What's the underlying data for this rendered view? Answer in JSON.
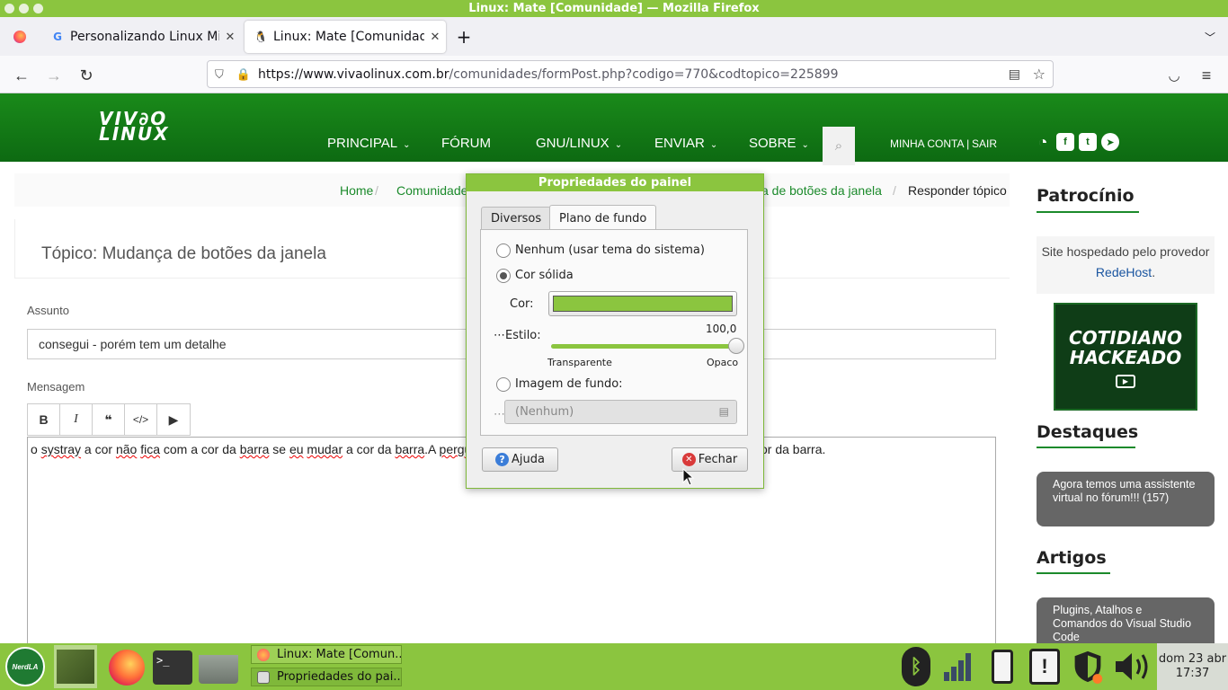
{
  "window": {
    "title": "Linux: Mate [Comunidade] — Mozilla Firefox"
  },
  "tabs": [
    {
      "label": "Personalizando Linux Mint -"
    },
    {
      "label": "Linux: Mate [Comunidade]"
    }
  ],
  "address": {
    "url_host": "https://www.vivaolinux.com.br",
    "url_path": "/comunidades/formPost.php?codigo=770&codtopico=225899"
  },
  "site": {
    "logo_line1": "VIV∂O",
    "logo_line2": "LINUX",
    "menu": [
      "PRINCIPAL",
      "FÓRUM",
      "GNU/LINUX",
      "ENVIAR",
      "SOBRE"
    ],
    "account": "MINHA CONTA",
    "logout": "SAIR"
  },
  "breadcrumb": {
    "home": "Home",
    "community": "Comunidade",
    "topic": "a de botões da janela",
    "current": "Responder tópico"
  },
  "topic_title": "Tópico: Mudança de botões da janela",
  "form": {
    "subject_label": "Assunto",
    "subject_value": "consegui - porém tem um detalhe",
    "message_label": "Mensagem",
    "message_parts": [
      "o ",
      "systray",
      " a cor ",
      "não",
      " ",
      "fica",
      " com a cor da ",
      "barra",
      " se ",
      "eu",
      " ",
      "mudar",
      " a cor da ",
      "barra",
      ".A ",
      "pergu"
    ],
    "message_tail": "or da barra."
  },
  "sidebar": {
    "sponsor_heading": "Patrocínio",
    "sponsor_text": "Site hospedado pelo provedor ",
    "sponsor_link": "RedeHost",
    "sponsor_dot": ".",
    "ad_line1": "COTIDIANO",
    "ad_line2": "HACKEADO",
    "highlights_heading": "Destaques",
    "highlight_item": "Agora temos uma assistente virtual no fórum!!! (157)",
    "articles_heading": "Artigos",
    "article_item": "Plugins, Atalhos e Comandos do Visual Studio Code"
  },
  "dialog": {
    "title": "Propriedades do painel",
    "tab_misc": "Diversos",
    "tab_background": "Plano de fundo",
    "opt_none": "Nenhum (usar tema do sistema)",
    "opt_solid": "Cor sólida",
    "color_label": "Cor:",
    "color_value": "#8bc53f",
    "style_label": "Estilo:",
    "style_value": "100,0",
    "slider_value": 1.0,
    "transparent_label": "Transparente",
    "opaque_label": "Opaco",
    "opt_image": "Imagem de fundo:",
    "image_placeholder": "(Nenhum)",
    "help_button": "Ajuda",
    "close_button": "Fechar"
  },
  "taskbar": {
    "windows": [
      "Linux: Mate [Comun...",
      "Propriedades do pai..."
    ],
    "clock_date": "dom 23 abr",
    "clock_time": "17:37",
    "menu_logo_text": "NerdLA"
  },
  "colors": {
    "accent": "#8bc53f",
    "site_green": "#0d6a12",
    "link_green": "#1b8a2b"
  }
}
